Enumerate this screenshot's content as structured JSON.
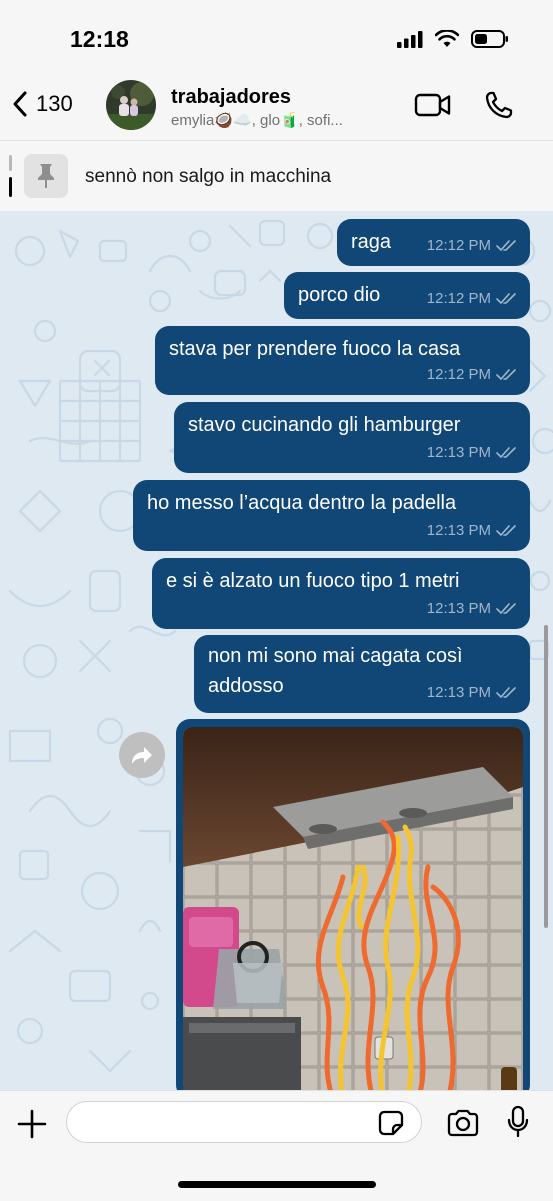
{
  "status": {
    "time": "12:18"
  },
  "header": {
    "back_count": "130",
    "title": "trabajadores",
    "members": "emylia🥥☁️, glo🧃, sofi..."
  },
  "pinned": {
    "text": "sennò non salgo in macchina"
  },
  "messages": [
    {
      "text": "raga",
      "time": "12:12 PM"
    },
    {
      "text": "porco dio",
      "time": "12:12 PM"
    },
    {
      "text": "stava per prendere fuoco la casa",
      "time": "12:12 PM"
    },
    {
      "text": "stavo cucinando gli hamburger",
      "time": "12:13 PM"
    },
    {
      "text": "ho messo l’acqua dentro la padella",
      "time": "12:13 PM"
    },
    {
      "text": "e si è alzato un fuoco tipo 1 metri",
      "time": "12:13 PM"
    },
    {
      "line1": "non mi sono mai cagata così",
      "line2": "addosso",
      "time": "12:13 PM"
    }
  ],
  "input": {
    "placeholder": ""
  },
  "colors": {
    "bubble": "#114776",
    "header_bg": "#f6f6f6",
    "wallpaper": "#dfe9f1"
  },
  "icons": [
    "back-chevron-icon",
    "video-call-icon",
    "phone-icon",
    "pin-icon",
    "forward-icon",
    "plus-icon",
    "sticker-icon",
    "camera-icon",
    "microphone-icon"
  ]
}
